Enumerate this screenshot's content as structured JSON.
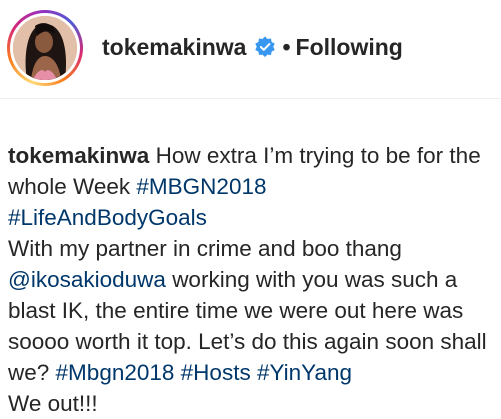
{
  "header": {
    "username": "tokemakinwa",
    "verified": true,
    "separator": "•",
    "follow_status": "Following"
  },
  "caption": {
    "username": "tokemakinwa",
    "line1_text": "How extra I’m trying to be for the whole Week",
    "hashtag1": "#MBGN2018",
    "hashtag2": "#LifeAndBodyGoals",
    "line2_text": "With my partner in crime and boo thang",
    "mention": "@ikosakioduwa",
    "line2_rest": "working with you was such a blast IK, the entire time we were out here was soooo worth it top. Let’s do this again soon shall we?",
    "hashtag3": "#Mbgn2018",
    "hashtag4": "#Hosts",
    "hashtag5": "#YinYang",
    "closing": "We out!!!"
  },
  "colors": {
    "link": "#00376b",
    "verified_badge": "#3897f0",
    "text": "#262626"
  },
  "icons": {
    "verified": "verified-badge-icon"
  }
}
